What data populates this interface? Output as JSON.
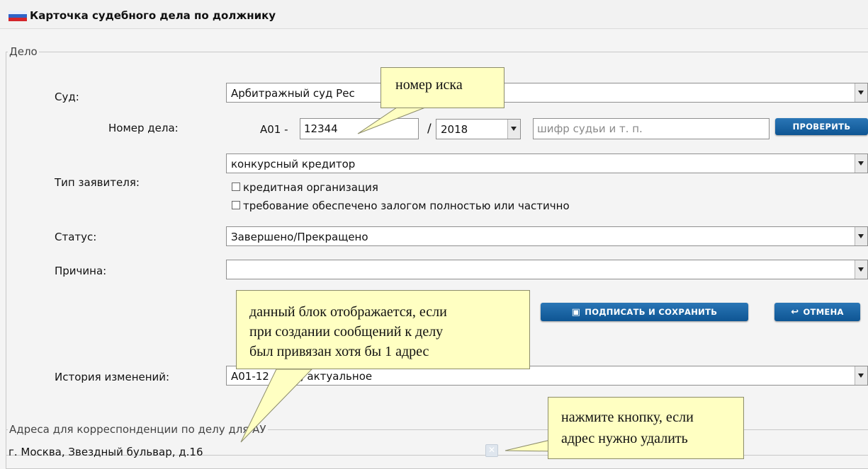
{
  "window": {
    "title": "Карточка судебного дела по должнику"
  },
  "case_section": {
    "legend": "Дело",
    "court": {
      "label": "Суд:",
      "value": "Арбитражный суд Рес"
    },
    "case_number": {
      "label": "Номер дела:",
      "prefix": "А01 -",
      "number": "12344",
      "separator": "/",
      "year": "2018",
      "judge_code_placeholder": "шифр судьи и т. п.",
      "check_button": "ПРОВЕРИТЬ"
    },
    "applicant_type": {
      "label": "Тип заявителя:",
      "value": "конкурсный кредитор",
      "checkbox_credit_org": "кредитная организация",
      "checkbox_collateral": "требование обеспечено залогом полностью или частично"
    },
    "status": {
      "label": "Статус:",
      "value": "Завершено/Прекращено"
    },
    "reason": {
      "label": "Причина:",
      "value": ""
    },
    "sign_save_button": "ПОДПИСАТЬ И СОХРАНИТЬ",
    "cancel_button": "ОТМЕНА",
    "history": {
      "label": "История изменений:",
      "value": "А01-12",
      "value_suffix": ", актуальное"
    }
  },
  "address_section": {
    "legend": "Адреса для корреспонденции по делу для АУ",
    "items": [
      "г. Москва, Звездный бульвар, д.16"
    ]
  },
  "callouts": {
    "claim_number": "номер иска",
    "address_block": [
      "данный блок отображается, если",
      "при создании сообщений к делу",
      "был привязан хотя бы 1 адрес"
    ],
    "delete_hint": [
      "нажмите кнопку, если",
      "адрес нужно удалить"
    ]
  },
  "icons": {
    "app_icon": "russian-flag-icon",
    "dropdown": "chevron-down-icon",
    "save": "floppy-disk-icon",
    "cancel": "undo-arrow-icon",
    "delete": "close-icon"
  },
  "colors": {
    "button": "#1565a7",
    "callout_bg": "#ffffc2",
    "border": "#8f8f8f"
  }
}
